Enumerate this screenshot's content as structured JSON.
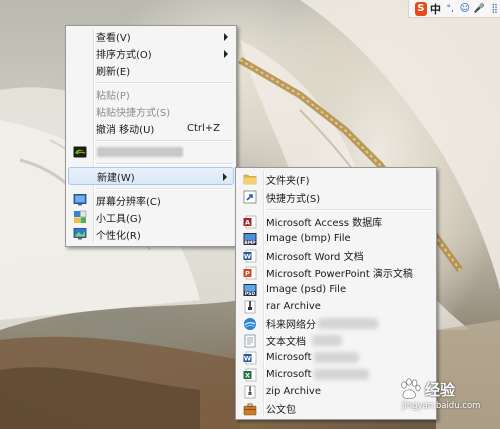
{
  "tray": {
    "ime_logo": "S",
    "ime_lang": "中",
    "ime_punct": "°,",
    "ime_emoji": "☺",
    "ime_mic": "🎤",
    "ime_more": "⣿"
  },
  "context_menu": {
    "items": [
      {
        "label": "查看(V)",
        "submenu": true
      },
      {
        "label": "排序方式(O)",
        "submenu": true
      },
      {
        "label": "刷新(E)"
      },
      {
        "label": "粘贴(P)",
        "disabled": true
      },
      {
        "label": "粘贴快捷方式(S)",
        "disabled": true
      },
      {
        "label": "撤消 移动(U)",
        "shortcut": "Ctrl+Z"
      },
      {
        "label": "新建(W)",
        "submenu": true
      },
      {
        "label": "屏幕分辨率(C)"
      },
      {
        "label": "小工具(G)"
      },
      {
        "label": "个性化(R)"
      }
    ]
  },
  "new_submenu": {
    "items": [
      {
        "label": "文件夹(F)",
        "icon": "folder-icon"
      },
      {
        "label": "快捷方式(S)",
        "icon": "shortcut-icon"
      },
      {
        "label": "Microsoft Access 数据库",
        "icon": "access-icon"
      },
      {
        "label": "Image (bmp) File",
        "icon": "bmp-icon"
      },
      {
        "label": "Microsoft Word 文档",
        "icon": "word-icon"
      },
      {
        "label": "Microsoft PowerPoint 演示文稿",
        "icon": "powerpoint-icon"
      },
      {
        "label": "Image (psd) File",
        "icon": "psd-icon"
      },
      {
        "label": "rar Archive",
        "icon": "rar-icon"
      },
      {
        "label": "科来网络分",
        "icon": "network-analyzer-icon"
      },
      {
        "label": "文本文档",
        "icon": "text-document-icon"
      },
      {
        "label": "Microsoft",
        "icon": "word-icon"
      },
      {
        "label": "Microsoft",
        "icon": "excel-icon"
      },
      {
        "label": "zip Archive",
        "icon": "zip-icon"
      },
      {
        "label": "公文包",
        "icon": "briefcase-icon"
      }
    ]
  },
  "watermark": {
    "brand": "经验",
    "url": "jingyan.baidu.com"
  },
  "colors": {
    "menu_bg": "#f5f5f5",
    "menu_border": "#979797",
    "hover_fill": "#d9e8f7",
    "hover_border": "#a8c8ec",
    "disabled_text": "#8d8d8d"
  }
}
